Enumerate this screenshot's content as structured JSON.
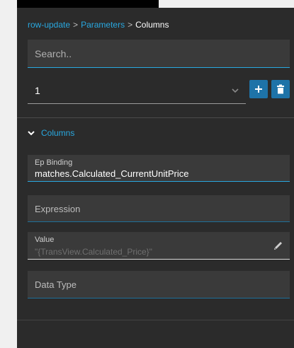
{
  "breadcrumb": {
    "items": [
      {
        "label": "row-update"
      },
      {
        "label": "Parameters"
      },
      {
        "label": "Columns"
      }
    ],
    "separator": ">"
  },
  "search": {
    "placeholder": "Search.."
  },
  "selector": {
    "value": "1"
  },
  "actions": {
    "add_icon": "plus-icon",
    "delete_icon": "trash-icon"
  },
  "section": {
    "title": "Columns",
    "expanded": true
  },
  "fields": {
    "ep_binding": {
      "label": "Ep Binding",
      "value": "matches.Calculated_CurrentUnitPrice"
    },
    "expression": {
      "label": "Expression"
    },
    "value": {
      "label": "Value",
      "placeholder": "\"{TransView.Calculated_Price}\""
    },
    "data_type": {
      "label": "Data Type"
    }
  },
  "colors": {
    "accent": "#29a8e0",
    "button": "#1e73a8",
    "panel": "#2b2b2b",
    "field": "#3a3a3a"
  }
}
